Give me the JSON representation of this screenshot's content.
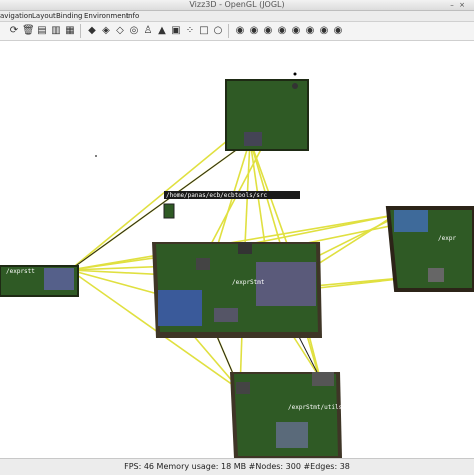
{
  "window": {
    "title": "Vizz3D - OpenGL (JOGL)"
  },
  "menu": {
    "items": [
      "avigation",
      "Layout",
      "Binding",
      "Environment",
      "Info"
    ]
  },
  "toolbar": {
    "icons": [
      "refresh-icon",
      "trash-icon",
      "save-icon",
      "chart-icon",
      "barchart-icon",
      "layout-icon",
      "layout-icon",
      "layout-icon",
      "layout-icon",
      "layout-icon",
      "layout-icon",
      "person-icon",
      "layout-icon",
      "layout-icon",
      "layout-icon",
      "layout-icon",
      "eye-icon",
      "eye-icon",
      "eye-icon",
      "eye-icon",
      "eye-icon",
      "eye-icon",
      "eye-icon",
      "eye-icon"
    ]
  },
  "graph": {
    "labels": {
      "path_label": "/home/panas/ecb/ecbtools/src",
      "left_label": "/exprstt",
      "right_label": "/expr",
      "center_label": "/exprStmt",
      "bottom_label": "/exprStmt/utils"
    }
  },
  "status": {
    "text": "FPS: 46   Memory usage: 18 MB   #Nodes: 300 #Edges: 38"
  }
}
